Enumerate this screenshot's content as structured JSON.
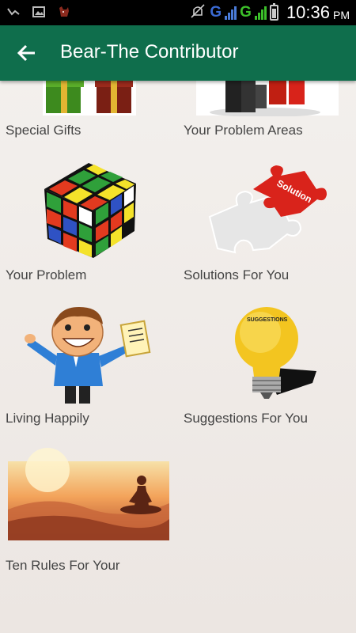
{
  "status_bar": {
    "time": "10:36",
    "ampm": "PM",
    "network1": "G",
    "network2": "G",
    "icons": [
      "check-icon",
      "gallery-icon",
      "animal-icon",
      "mute-icon",
      "signal-icon",
      "battery-icon"
    ]
  },
  "app_bar": {
    "title": "Bear-The Contributor",
    "back_icon": "arrow-left-icon",
    "color": "#0f6e4c"
  },
  "tiles": [
    {
      "label": "Special Gifts",
      "icon": "gift-boxes-image"
    },
    {
      "label": "Your Problem Areas",
      "icon": "chess-pieces-image"
    },
    {
      "label": "Your Problem",
      "icon": "rubiks-cube-image"
    },
    {
      "label": "Solutions For You",
      "icon": "puzzle-solution-image"
    },
    {
      "label": "Living Happily",
      "icon": "happy-man-image"
    },
    {
      "label": "Suggestions For You",
      "icon": "light-bulb-image"
    },
    {
      "label": "Ten Rules For Your",
      "icon": "meditation-sunset-image"
    }
  ],
  "bulb_text": "SUGGESTIONS",
  "puzzle_text": "Solution"
}
